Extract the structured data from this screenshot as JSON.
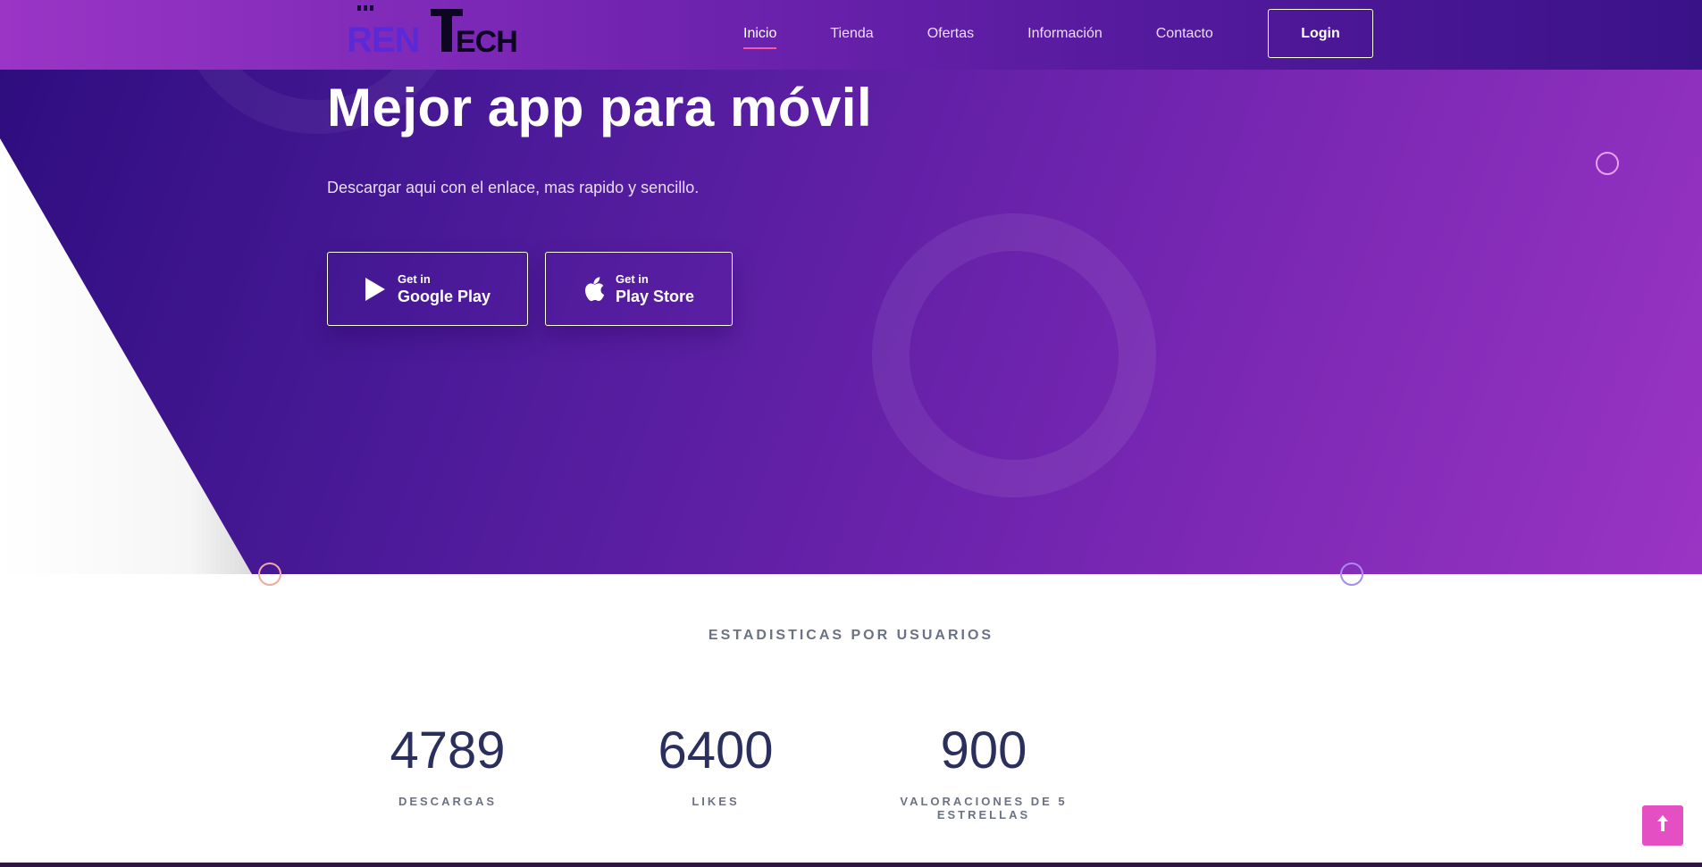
{
  "brand": {
    "logo_text_left": "REN",
    "logo_text_right": "TECH"
  },
  "nav": {
    "items": [
      {
        "label": "Inicio",
        "active": true
      },
      {
        "label": "Tienda",
        "active": false
      },
      {
        "label": "Ofertas",
        "active": false
      },
      {
        "label": "Información",
        "active": false
      },
      {
        "label": "Contacto",
        "active": false
      }
    ],
    "login_label": "Login"
  },
  "hero": {
    "title": "Mejor app para móvil",
    "subtitle": "Descargar aqui con el enlace, mas rapido y sencillo.",
    "buttons": [
      {
        "small": "Get in",
        "big": "Google Play",
        "icon": "play-icon"
      },
      {
        "small": "Get in",
        "big": "Play Store",
        "icon": "apple-icon"
      }
    ]
  },
  "stats": {
    "heading": "ESTADISTICAS POR USUARIOS",
    "items": [
      {
        "value": "4789",
        "label": "DESCARGAS"
      },
      {
        "value": "6400",
        "label": "LIKES"
      },
      {
        "value": "900",
        "label": "VALORACIONES DE 5 ESTRELLAS"
      }
    ]
  },
  "colors": {
    "accent_pink": "#f05aa8",
    "scroll_top_bg": "#e44fc4",
    "stat_value": "#2a2f5e",
    "hero_gradient_start": "#2d0d7e",
    "hero_gradient_end": "#9a34c4"
  },
  "icons": {
    "scroll_top": "arrow-up-icon"
  }
}
